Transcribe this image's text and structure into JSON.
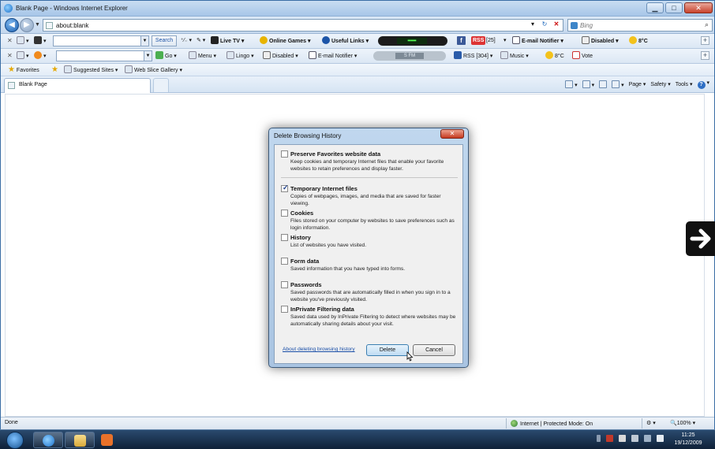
{
  "window": {
    "title": "Blank Page - Windows Internet Explorer",
    "minimize": "▁",
    "maximize": "□",
    "close": "✕"
  },
  "address_bar": {
    "url": "about:blank",
    "search_placeholder": "Bing"
  },
  "toolbar1": {
    "search_label": "Search",
    "live_tv": "Live TV",
    "online_games": "Online Games",
    "useful_links": "Useful Links",
    "rss_count": "[25]",
    "rss_badge": "RSS",
    "email_notifier": "E-mail Notifier",
    "disabled": "Disabled",
    "weather": "8°C"
  },
  "toolbar2": {
    "go": "Go",
    "menu": "Menu",
    "lingo": "Lingo",
    "disabled": "Disabled",
    "email_notifier": "E-mail Notifier",
    "radio_display": "S FM",
    "rss": "RSS [304]",
    "music": "Music",
    "weather": "8°C",
    "vote": "Vote"
  },
  "favorites_bar": {
    "favorites": "Favorites",
    "suggested_sites": "Suggested Sites ▾",
    "web_slice_gallery": "Web Slice Gallery ▾"
  },
  "tabs": [
    {
      "label": "Blank Page"
    }
  ],
  "command_bar": {
    "page": "Page ▾",
    "safety": "Safety ▾",
    "tools": "Tools ▾"
  },
  "dialog": {
    "title": "Delete Browsing History",
    "close_label": "✕",
    "options": [
      {
        "title": "Preserve Favorites website data",
        "checked": false,
        "desc": "Keep cookies and temporary Internet files that enable your favorite websites to retain preferences and display faster."
      },
      {
        "title": "Temporary Internet files",
        "checked": true,
        "desc": "Copies of webpages, images, and media that are saved for faster viewing."
      },
      {
        "title": "Cookies",
        "checked": false,
        "desc": "Files stored on your computer by websites to save preferences such as login information."
      },
      {
        "title": "History",
        "checked": false,
        "desc": "List of websites you have visited."
      },
      {
        "title": "Form data",
        "checked": false,
        "desc": "Saved information that you have typed into forms."
      },
      {
        "title": "Passwords",
        "checked": false,
        "desc": "Saved passwords that are automatically filled in when you sign in to a website you've previously visited."
      },
      {
        "title": "InPrivate Filtering data",
        "checked": false,
        "desc": "Saved data used by InPrivate Filtering to detect where websites may be automatically sharing details about your visit."
      }
    ],
    "help_link": "About deleting browsing history",
    "delete_label": "Delete",
    "cancel_label": "Cancel"
  },
  "status_bar": {
    "status": "Done",
    "zone": "Internet | Protected Mode: On",
    "zoom": "100%"
  },
  "taskbar": {
    "time": "11:25",
    "date": "19/12/2009"
  }
}
